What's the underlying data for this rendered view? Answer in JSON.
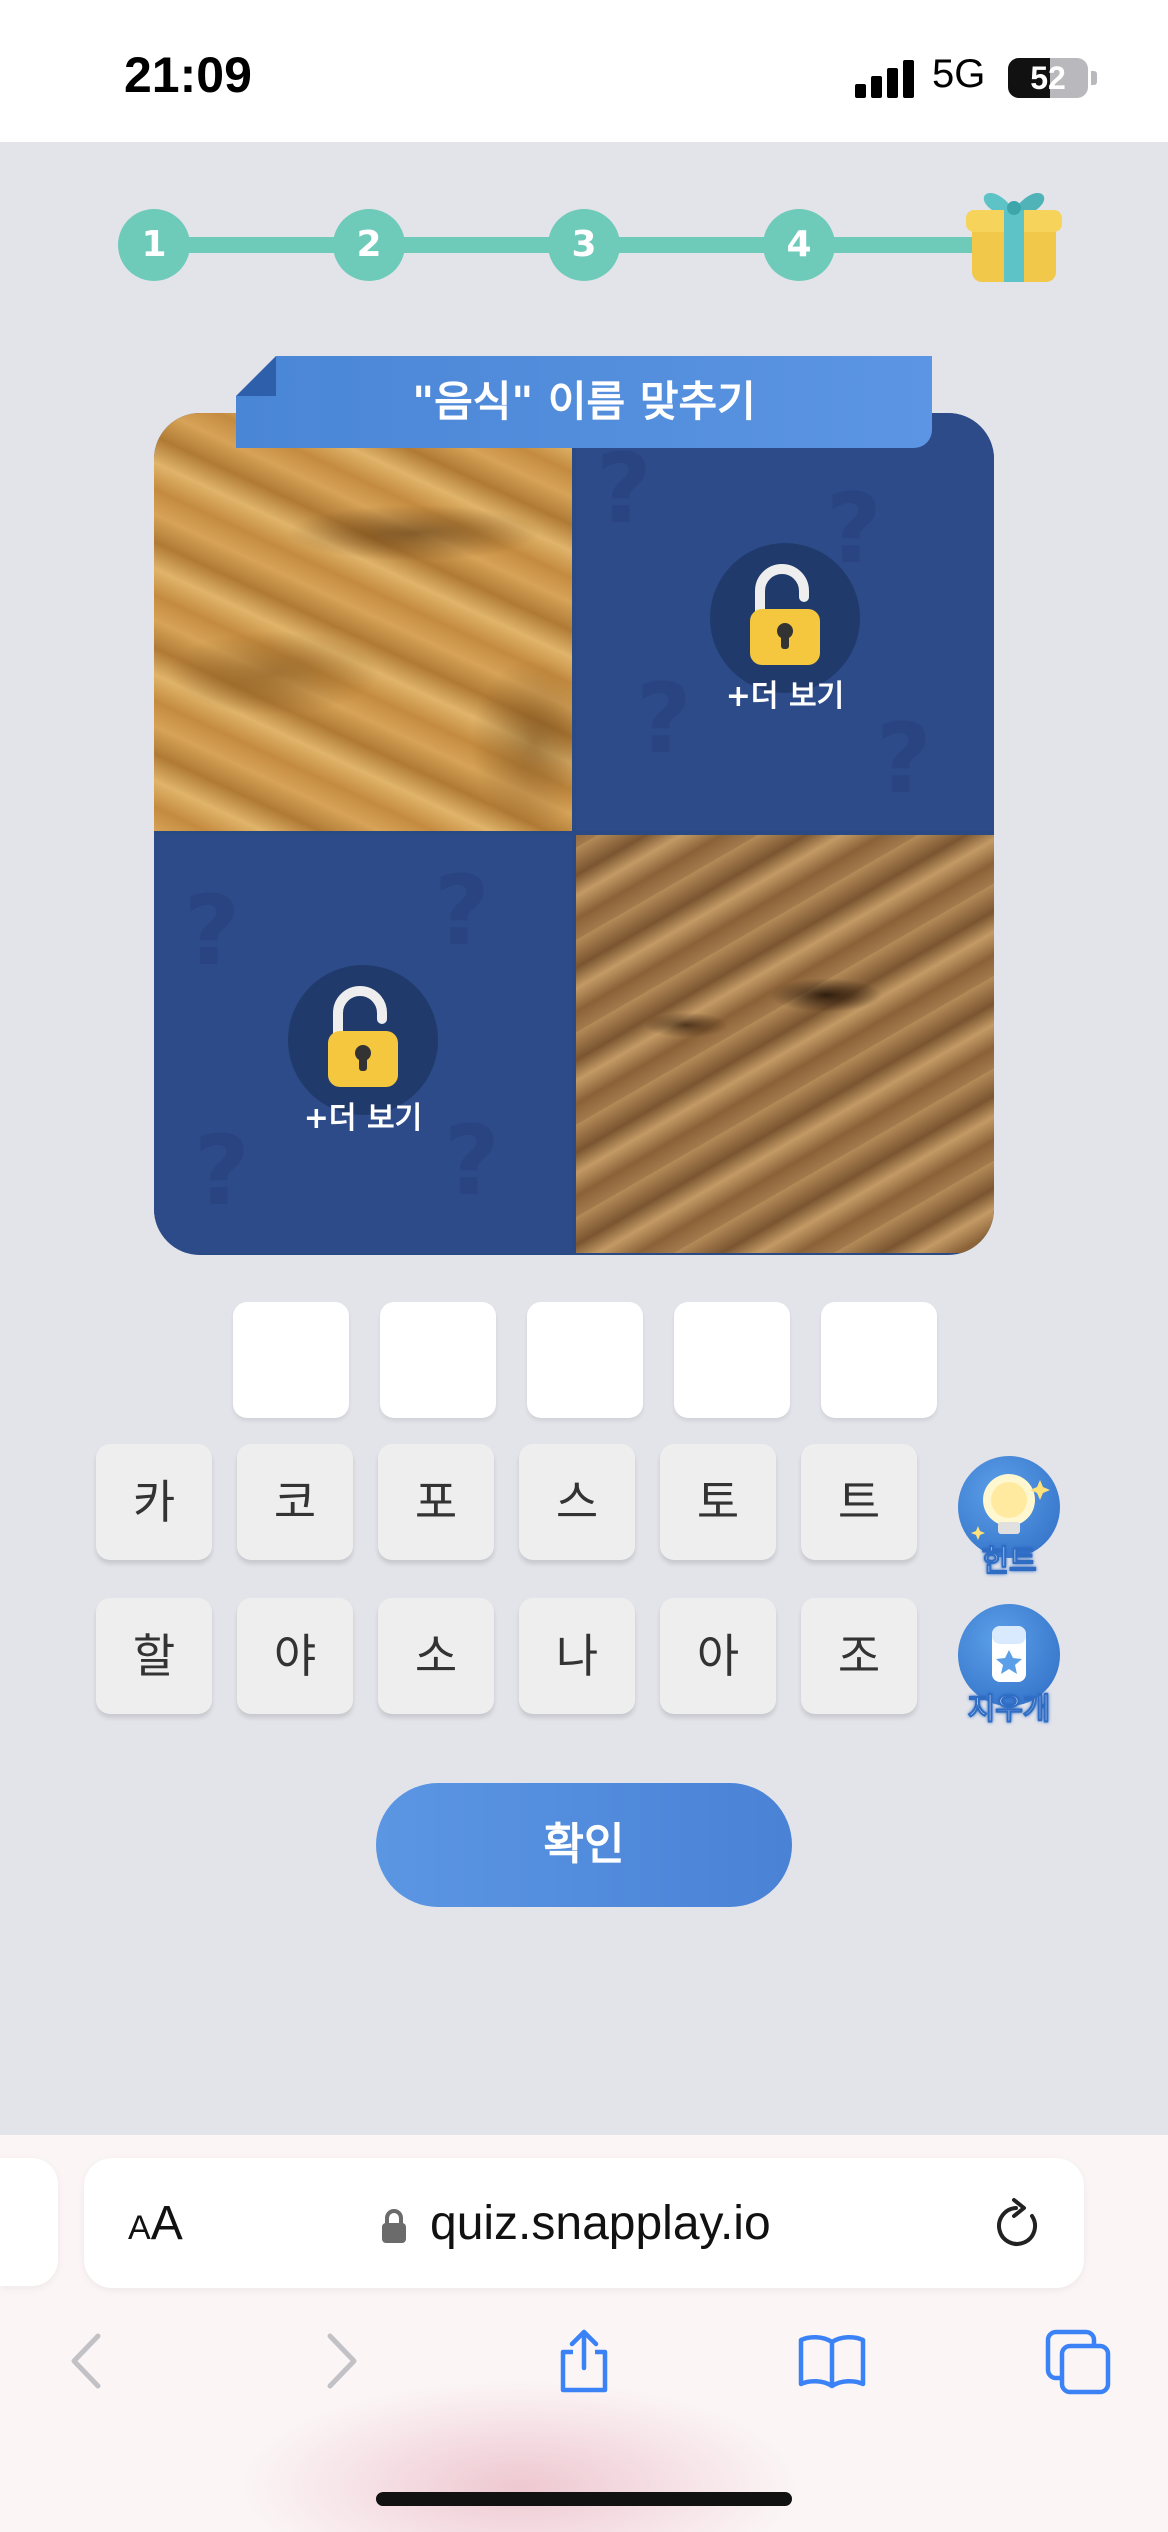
{
  "status_bar": {
    "time": "21:09",
    "network": "5G",
    "battery": "52"
  },
  "progress": {
    "steps": [
      "1",
      "2",
      "3",
      "4"
    ]
  },
  "quiz": {
    "title": "\"음식\" 이름 맞추기",
    "tiles": [
      {
        "state": "revealed"
      },
      {
        "state": "locked",
        "label": "+더 보기"
      },
      {
        "state": "locked",
        "label": "+더 보기"
      },
      {
        "state": "revealed"
      }
    ]
  },
  "answer_slot_count": 5,
  "keys": {
    "row1": [
      "카",
      "코",
      "포",
      "스",
      "토",
      "트"
    ],
    "row2": [
      "할",
      "야",
      "소",
      "나",
      "아",
      "조"
    ]
  },
  "tools": {
    "hint_label": "힌트",
    "eraser_label": "지우개"
  },
  "confirm_label": "확인",
  "browser": {
    "text_size_big": "A",
    "text_size_small": "A",
    "url": "quiz.snapplay.io"
  },
  "colors": {
    "progress": "#6ecab9",
    "accent": "#4a86d6",
    "tile_locked": "#2c4b88"
  }
}
